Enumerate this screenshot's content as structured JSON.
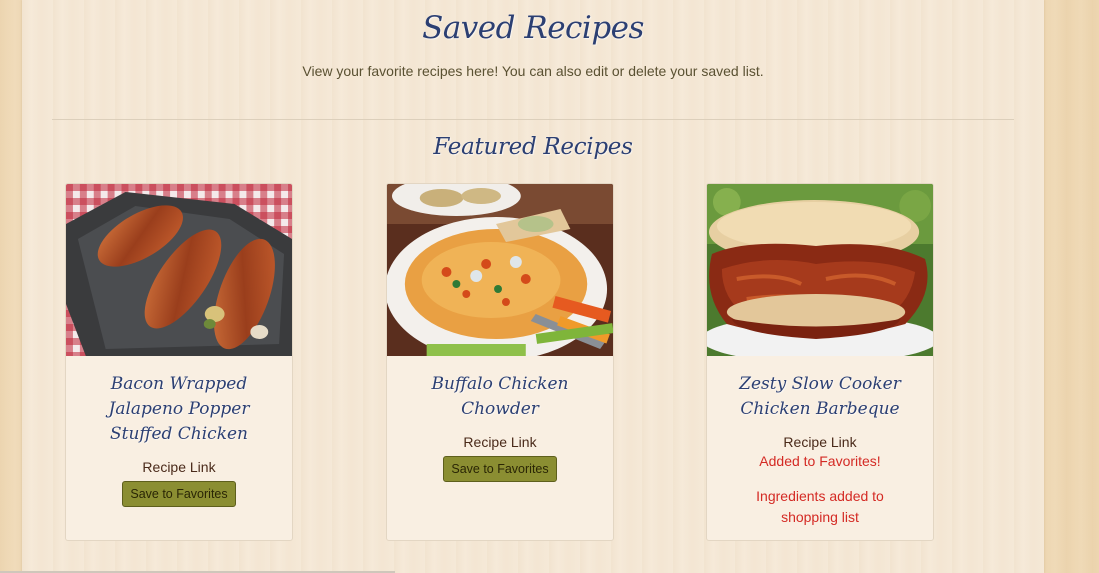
{
  "header": {
    "title": "Saved Recipes",
    "subtitle": "View your favorite recipes here! You can also edit or delete your saved list."
  },
  "featured": {
    "title": "Featured Recipes"
  },
  "cards": [
    {
      "title": "Bacon Wrapped Jalapeno Popper Stuffed Chicken",
      "image_icon": "bacon-wrapped-chicken-photo",
      "link_label": "Recipe Link",
      "save_label": "Save to Favorites"
    },
    {
      "title": "Buffalo Chicken Chowder",
      "image_icon": "buffalo-chowder-photo",
      "link_label": "Recipe Link",
      "save_label": "Save to Favorites"
    },
    {
      "title": "Zesty Slow Cooker Chicken Barbeque",
      "image_icon": "bbq-sandwich-photo",
      "link_label": "Recipe Link",
      "added_label": "Added to Favorites!",
      "ingredients_label": "Ingredients added to shopping list"
    }
  ],
  "colors": {
    "heading": "#2c3f72",
    "button": "#8b8e32",
    "status": "#d42a24"
  }
}
